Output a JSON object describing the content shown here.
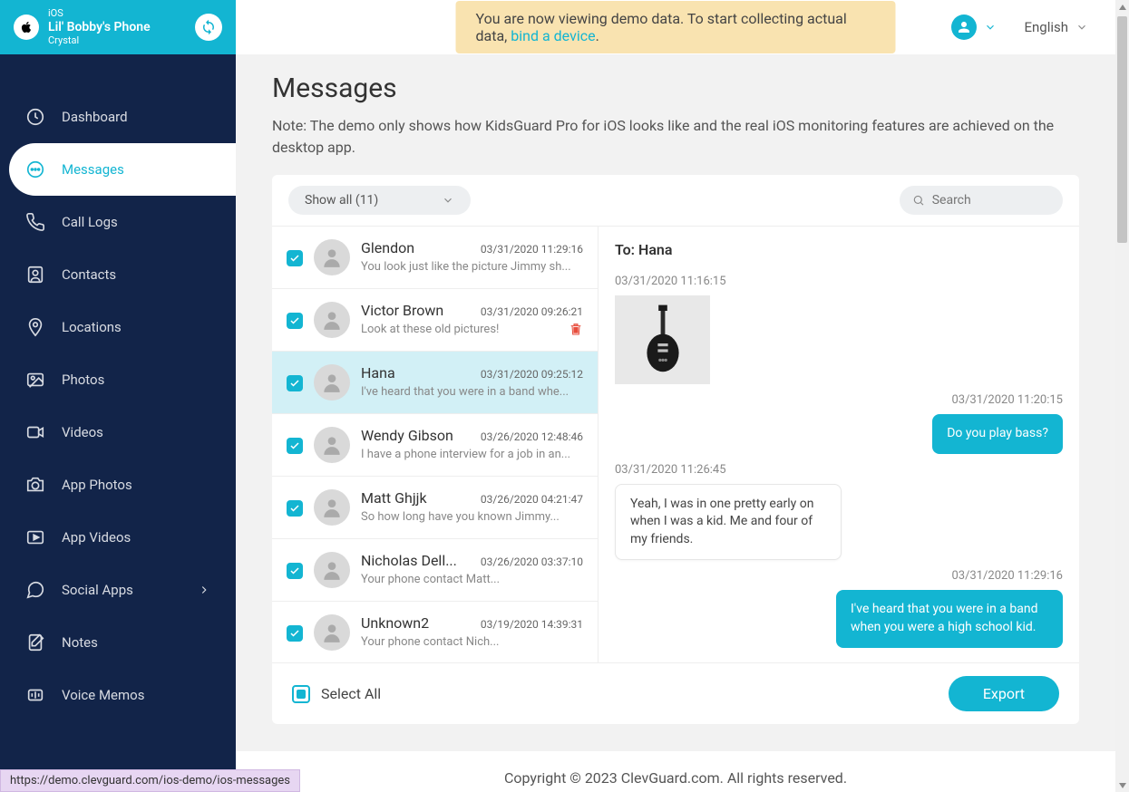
{
  "sidebar": {
    "os": "iOS",
    "device": "Lil' Bobby's Phone",
    "user": "Crystal",
    "items": [
      {
        "label": "Dashboard",
        "icon": "dashboard"
      },
      {
        "label": "Messages",
        "icon": "messages"
      },
      {
        "label": "Call Logs",
        "icon": "call"
      },
      {
        "label": "Contacts",
        "icon": "contacts"
      },
      {
        "label": "Locations",
        "icon": "location"
      },
      {
        "label": "Photos",
        "icon": "photos"
      },
      {
        "label": "Videos",
        "icon": "videos"
      },
      {
        "label": "App Photos",
        "icon": "camera"
      },
      {
        "label": "App Videos",
        "icon": "play"
      },
      {
        "label": "Social Apps",
        "icon": "chat",
        "arrow": true
      },
      {
        "label": "Notes",
        "icon": "notes"
      },
      {
        "label": "Voice Memos",
        "icon": "voice"
      }
    ],
    "active_index": 1
  },
  "topbar": {
    "banner_pre": "You are now viewing demo data. To start collecting actual data, ",
    "banner_link": "bind a device",
    "banner_post": ".",
    "language": "English"
  },
  "page": {
    "title": "Messages",
    "note": "Note: The demo only shows how KidsGuard Pro for iOS looks like and the real iOS monitoring features are achieved on the desktop app."
  },
  "filter": {
    "label": "Show all (11)"
  },
  "search": {
    "placeholder": "Search"
  },
  "conversations": [
    {
      "name": "Glendon",
      "time": "03/31/2020  11:29:16",
      "preview": "You look just like the picture Jimmy sh..."
    },
    {
      "name": "Victor Brown",
      "time": "03/31/2020  09:26:21",
      "preview": "Look at these old pictures!",
      "trash": true
    },
    {
      "name": "Hana",
      "time": "03/31/2020  09:25:12",
      "preview": "I've heard that you were in a band whe..."
    },
    {
      "name": "Wendy Gibson",
      "time": "03/26/2020  12:48:46",
      "preview": "I have a phone interview for a job in an..."
    },
    {
      "name": "Matt Ghjjk",
      "time": "03/26/2020  04:21:47",
      "preview": "So how long have you known Jimmy..."
    },
    {
      "name": "Nicholas Dell...",
      "time": "03/26/2020  03:37:10",
      "preview": "Your phone contact Matt..."
    },
    {
      "name": "Unknown2",
      "time": "03/19/2020  14:39:31",
      "preview": "Your phone contact Nich..."
    }
  ],
  "active_conversation": 2,
  "chat": {
    "to_label": "To: Hana",
    "messages": [
      {
        "dir": "in",
        "time": "03/31/2020  11:16:15",
        "image": true
      },
      {
        "dir": "out",
        "time": "03/31/2020  11:20:15",
        "text": "Do you play bass?"
      },
      {
        "dir": "in",
        "time": "03/31/2020  11:26:45",
        "text": "Yeah, I was in one pretty early on when I was a kid. Me and four of my friends."
      },
      {
        "dir": "out",
        "time": "03/31/2020  11:29:16",
        "text": "I've heard that you were in a band when you were a high school kid."
      }
    ]
  },
  "bottom": {
    "select_all": "Select All",
    "export": "Export"
  },
  "footer": "Copyright © 2023 ClevGuard.com. All rights reserved.",
  "status_url": "https://demo.clevguard.com/ios-demo/ios-messages"
}
